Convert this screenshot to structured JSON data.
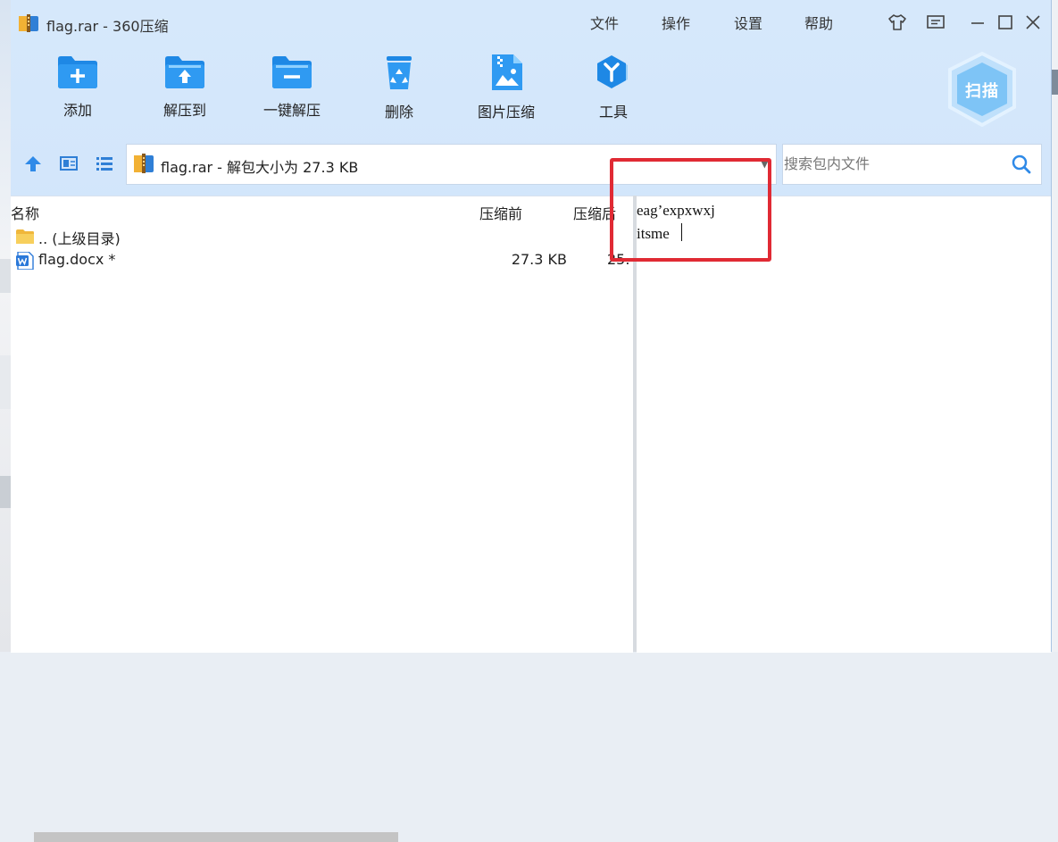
{
  "window": {
    "title": "flag.rar - 360压缩",
    "menu": [
      "文件",
      "操作",
      "设置",
      "帮助"
    ],
    "controls": [
      "skin-icon",
      "feedback-icon",
      "minimize-icon",
      "maximize-icon",
      "close-icon"
    ]
  },
  "toolbar": {
    "items": [
      {
        "label": "添加",
        "icon": "add-folder-icon"
      },
      {
        "label": "解压到",
        "icon": "extract-to-icon"
      },
      {
        "label": "一键解压",
        "icon": "one-click-extract-icon"
      },
      {
        "label": "删除",
        "icon": "recycle-bin-icon"
      },
      {
        "label": "图片压缩",
        "icon": "image-compress-icon"
      },
      {
        "label": "工具",
        "icon": "tools-icon"
      }
    ],
    "scan_label": "扫描"
  },
  "address": {
    "path": "flag.rar - 解包大小为 27.3 KB",
    "search_placeholder": "搜索包内文件"
  },
  "file_list": {
    "columns": [
      "名称",
      "压缩前",
      "压缩后"
    ],
    "rows": [
      {
        "name": ".. (上级目录)",
        "size": "",
        "compressed": "",
        "icon": "folder-icon"
      },
      {
        "name": "flag.docx *",
        "size": "27.3 KB",
        "compressed": "25.",
        "icon": "word-doc-icon"
      }
    ]
  },
  "preview": {
    "lines": [
      "eag’expxwxj",
      "itsme"
    ]
  },
  "colors": {
    "accent": "#2a8ff0",
    "highlight": "#e02a34"
  }
}
